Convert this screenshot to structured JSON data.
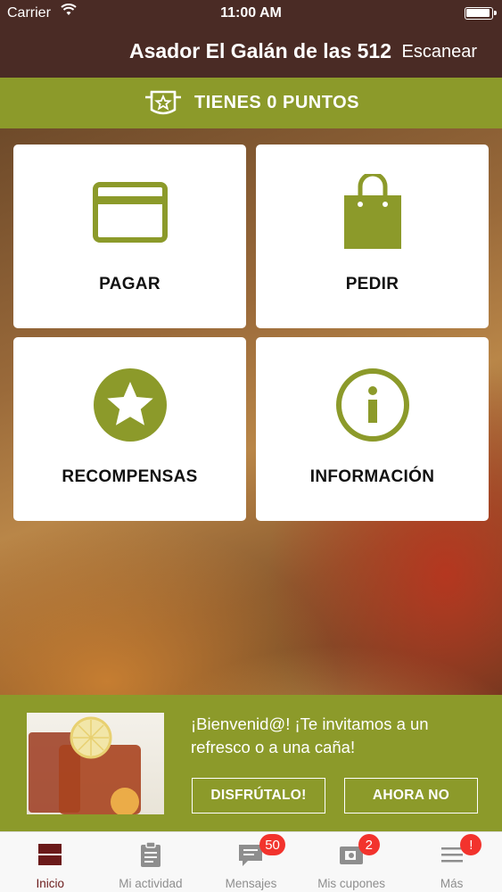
{
  "status_bar": {
    "carrier": "Carrier",
    "time": "11:00 AM"
  },
  "nav": {
    "title": "Asador El Galán de las 512",
    "scan_label": "Escanear"
  },
  "points": {
    "label": "TIENES 0 PUNTOS"
  },
  "tiles": {
    "pay": {
      "label": "PAGAR",
      "icon": "credit-card-icon"
    },
    "order": {
      "label": "PEDIR",
      "icon": "shopping-bag-icon"
    },
    "rewards": {
      "label": "RECOMPENSAS",
      "icon": "star-icon"
    },
    "info": {
      "label": "INFORMACIÓN",
      "icon": "info-icon"
    }
  },
  "promo": {
    "message": "¡Bienvenid@! ¡Te invitamos a un refresco o a una caña!",
    "accept_label": "DISFRÚTALO!",
    "decline_label": "AHORA NO"
  },
  "tabbar": {
    "tabs": [
      {
        "label": "Inicio",
        "icon": "home-icon",
        "active": true
      },
      {
        "label": "Mi actividad",
        "icon": "clipboard-icon"
      },
      {
        "label": "Mensajes",
        "icon": "chat-icon",
        "badge": "50"
      },
      {
        "label": "Mis cupones",
        "icon": "coupon-icon",
        "badge": "2"
      },
      {
        "label": "Más",
        "icon": "menu-icon",
        "badge": "!"
      }
    ]
  },
  "colors": {
    "brand_dark": "#4a2b25",
    "brand_green": "#8c9a2a",
    "badge_red": "#f2332d",
    "active_tab": "#6b1a1a"
  }
}
